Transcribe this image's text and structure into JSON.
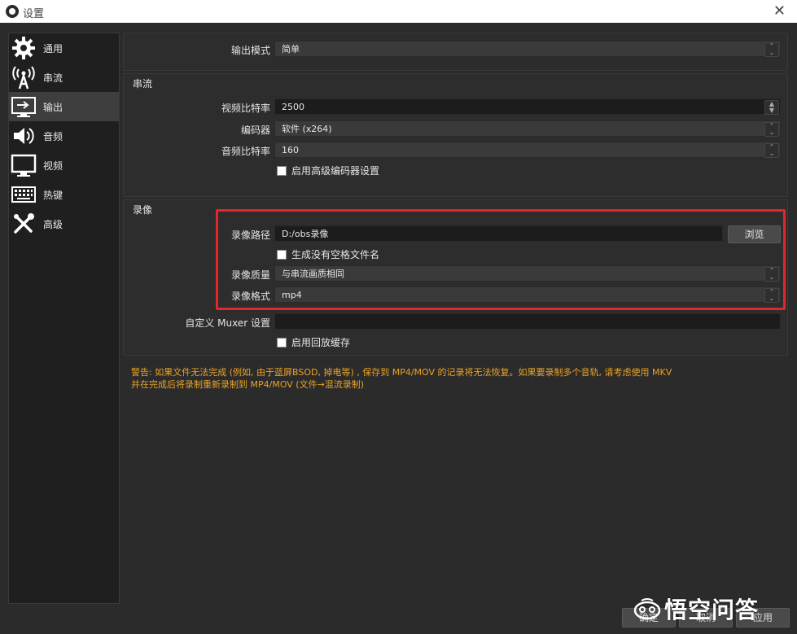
{
  "window": {
    "title": "设置",
    "close": "✕"
  },
  "sidebar": {
    "items": [
      {
        "label": "通用",
        "icon": "gear-icon"
      },
      {
        "label": "串流",
        "icon": "antenna-icon"
      },
      {
        "label": "输出",
        "icon": "output-icon",
        "active": true
      },
      {
        "label": "音频",
        "icon": "speaker-icon"
      },
      {
        "label": "视频",
        "icon": "monitor-icon"
      },
      {
        "label": "热键",
        "icon": "keyboard-icon"
      },
      {
        "label": "高级",
        "icon": "tools-icon"
      }
    ]
  },
  "output": {
    "mode_label": "输出模式",
    "mode_value": "简单"
  },
  "streaming": {
    "title": "串流",
    "video_bitrate_label": "视频比特率",
    "video_bitrate_value": "2500",
    "encoder_label": "编码器",
    "encoder_value": "软件 (x264)",
    "audio_bitrate_label": "音频比特率",
    "audio_bitrate_value": "160",
    "advanced_encoder_label": "启用高级编码器设置"
  },
  "recording": {
    "title": "录像",
    "path_label": "录像路径",
    "path_value": "D:/obs录像",
    "browse_label": "浏览",
    "no_space_label": "生成没有空格文件名",
    "quality_label": "录像质量",
    "quality_value": "与串流画质相同",
    "format_label": "录像格式",
    "format_value": "mp4",
    "muxer_label": "自定义 Muxer 设置",
    "muxer_value": "",
    "replay_buffer_label": "启用回放缓存"
  },
  "warning": {
    "line1": "警告: 如果文件无法完成 (例如, 由于蓝屏BSOD, 掉电等) , 保存到 MP4/MOV 的记录将无法恢复。如果要录制多个音轨, 请考虑使用 MKV",
    "line2": "并在完成后将录制重新录制到 MP4/MOV (文件→混流录制)"
  },
  "footer": {
    "ok_label": "确定",
    "cancel_label": "取消",
    "apply_label": "应用"
  },
  "watermark": {
    "text": "悟空问答"
  },
  "colors": {
    "highlight": "#e3262c",
    "warning": "#e9a227",
    "background": "#2b2b2b"
  }
}
